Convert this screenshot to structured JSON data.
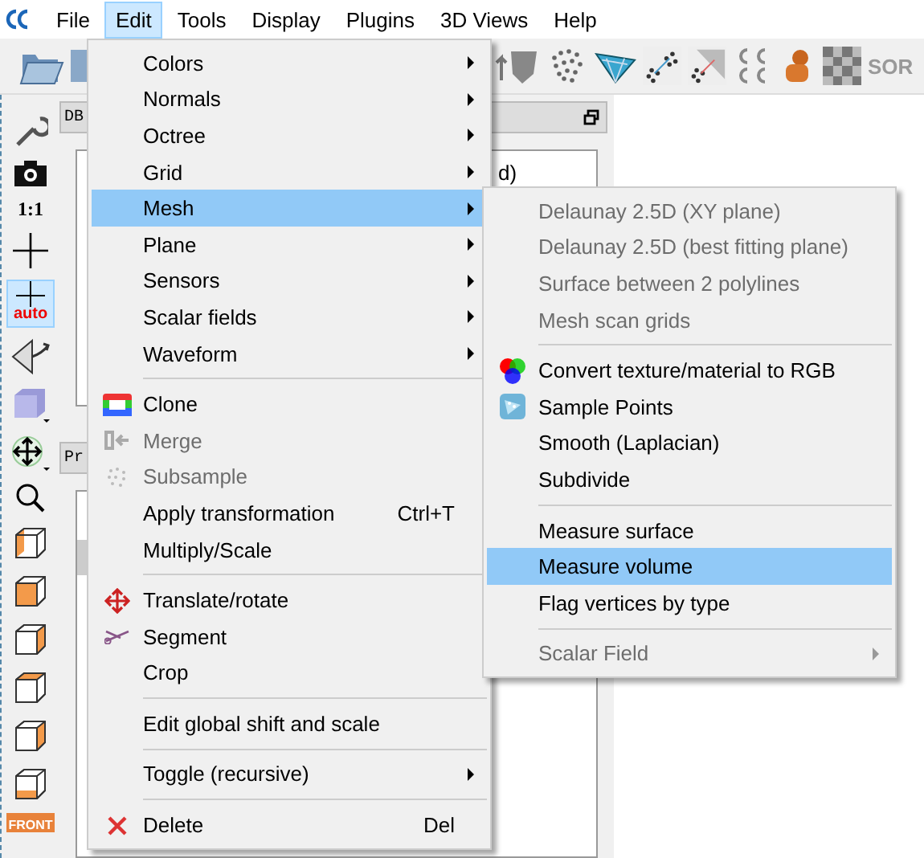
{
  "menubar": [
    {
      "label": "File",
      "selected": false
    },
    {
      "label": "Edit",
      "selected": true
    },
    {
      "label": "Tools",
      "selected": false
    },
    {
      "label": "Display",
      "selected": false
    },
    {
      "label": "Plugins",
      "selected": false
    },
    {
      "label": "3D Views",
      "selected": false
    },
    {
      "label": "Help",
      "selected": false
    }
  ],
  "toolbar": {
    "cut_label": "SOR"
  },
  "left_toolbar": {
    "one_to_one": "1:1",
    "auto_pick": {
      "label": "auto",
      "selected": true
    },
    "front_view": "FRONT"
  },
  "db_panel": {
    "tab": "DB",
    "tree_text": "d)"
  },
  "properties_panel": {
    "tab": "Pr"
  },
  "edit_menu": [
    {
      "kind": "item",
      "label": "Colors",
      "submenu": true,
      "disabled": false,
      "selected": false
    },
    {
      "kind": "item",
      "label": "Normals",
      "submenu": true,
      "disabled": false,
      "selected": false
    },
    {
      "kind": "item",
      "label": "Octree",
      "submenu": true,
      "disabled": false,
      "selected": false
    },
    {
      "kind": "item",
      "label": "Grid",
      "submenu": true,
      "disabled": false,
      "selected": false
    },
    {
      "kind": "item",
      "label": "Mesh",
      "submenu": true,
      "disabled": false,
      "selected": true
    },
    {
      "kind": "item",
      "label": "Plane",
      "submenu": true,
      "disabled": false,
      "selected": false
    },
    {
      "kind": "item",
      "label": "Sensors",
      "submenu": true,
      "disabled": false,
      "selected": false
    },
    {
      "kind": "item",
      "label": "Scalar fields",
      "submenu": true,
      "disabled": false,
      "selected": false
    },
    {
      "kind": "item",
      "label": "Waveform",
      "submenu": true,
      "disabled": false,
      "selected": false
    },
    {
      "kind": "separator"
    },
    {
      "kind": "item",
      "label": "Clone",
      "submenu": false,
      "disabled": false,
      "selected": false
    },
    {
      "kind": "item",
      "label": "Merge",
      "submenu": false,
      "disabled": true,
      "selected": false
    },
    {
      "kind": "item",
      "label": "Subsample",
      "submenu": false,
      "disabled": true,
      "selected": false
    },
    {
      "kind": "item",
      "label": "Apply transformation",
      "shortcut": "Ctrl+T",
      "submenu": false,
      "disabled": false,
      "selected": false
    },
    {
      "kind": "item",
      "label": "Multiply/Scale",
      "submenu": false,
      "disabled": false,
      "selected": false
    },
    {
      "kind": "separator"
    },
    {
      "kind": "item",
      "label": "Translate/rotate",
      "submenu": false,
      "disabled": false,
      "selected": false
    },
    {
      "kind": "item",
      "label": "Segment",
      "submenu": false,
      "disabled": false,
      "selected": false
    },
    {
      "kind": "item",
      "label": "Crop",
      "submenu": false,
      "disabled": false,
      "selected": false
    },
    {
      "kind": "separator"
    },
    {
      "kind": "item",
      "label": "Edit global shift and scale",
      "submenu": false,
      "disabled": false,
      "selected": false
    },
    {
      "kind": "separator"
    },
    {
      "kind": "item",
      "label": "Toggle (recursive)",
      "submenu": true,
      "disabled": false,
      "selected": false
    },
    {
      "kind": "separator"
    },
    {
      "kind": "item",
      "label": "Delete",
      "shortcut": "Del",
      "submenu": false,
      "disabled": false,
      "selected": false
    }
  ],
  "mesh_menu": [
    {
      "kind": "item",
      "label": "Delaunay 2.5D (XY plane)",
      "submenu": false,
      "disabled": true,
      "selected": false
    },
    {
      "kind": "item",
      "label": "Delaunay 2.5D (best fitting plane)",
      "submenu": false,
      "disabled": true,
      "selected": false
    },
    {
      "kind": "item",
      "label": "Surface between 2 polylines",
      "submenu": false,
      "disabled": true,
      "selected": false
    },
    {
      "kind": "item",
      "label": "Mesh scan grids",
      "submenu": false,
      "disabled": true,
      "selected": false
    },
    {
      "kind": "separator"
    },
    {
      "kind": "item",
      "label": "Convert texture/material to RGB",
      "submenu": false,
      "disabled": false,
      "selected": false
    },
    {
      "kind": "item",
      "label": "Sample Points",
      "submenu": false,
      "disabled": false,
      "selected": false
    },
    {
      "kind": "item",
      "label": "Smooth (Laplacian)",
      "submenu": false,
      "disabled": false,
      "selected": false
    },
    {
      "kind": "item",
      "label": "Subdivide",
      "submenu": false,
      "disabled": false,
      "selected": false
    },
    {
      "kind": "separator"
    },
    {
      "kind": "item",
      "label": "Measure surface",
      "submenu": false,
      "disabled": false,
      "selected": false
    },
    {
      "kind": "item",
      "label": "Measure volume",
      "submenu": false,
      "disabled": false,
      "selected": true
    },
    {
      "kind": "item",
      "label": "Flag vertices by type",
      "submenu": false,
      "disabled": false,
      "selected": false
    },
    {
      "kind": "separator"
    },
    {
      "kind": "item",
      "label": "Scalar Field",
      "submenu": true,
      "disabled": true,
      "selected": false
    }
  ]
}
